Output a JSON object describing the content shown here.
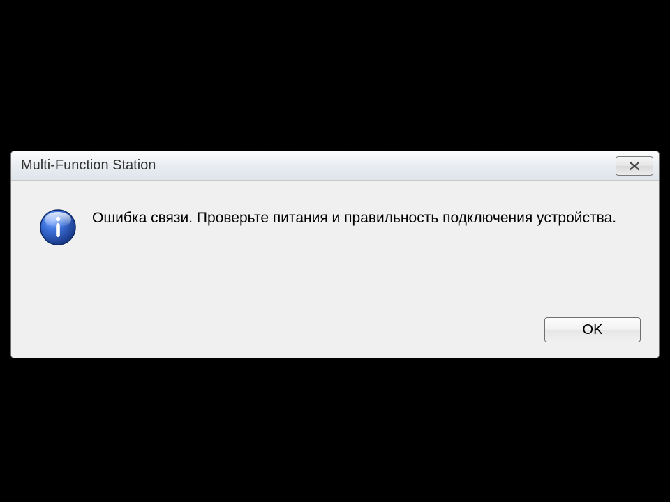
{
  "dialog": {
    "title": "Multi-Function Station",
    "message": "Ошибка связи. Проверьте питания и правильность подключения устройства.",
    "ok_label": "OK"
  }
}
